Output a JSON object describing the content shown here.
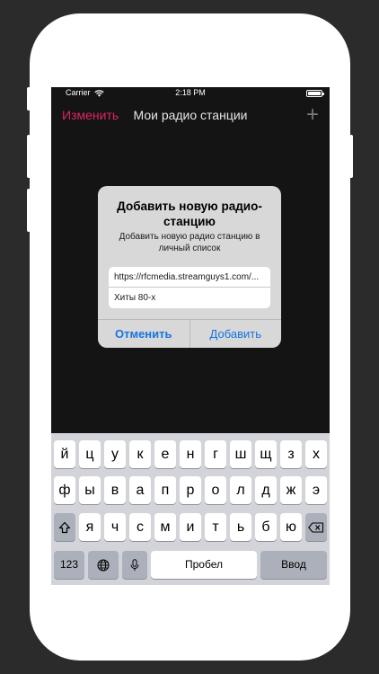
{
  "status_bar": {
    "carrier": "Carrier",
    "time": "2:18 PM"
  },
  "nav": {
    "edit_label": "Изменить",
    "title": "Мои радио станции",
    "add_label": "+"
  },
  "alert": {
    "title": "Добавить новую радио-станцию",
    "message": "Добавить новую радио станцию в личный список",
    "url_value": "https://rfcmedia.streamguys1.com/...",
    "name_value": "Хиты 80-х",
    "cancel_label": "Отменить",
    "add_label": "Добавить"
  },
  "keyboard": {
    "row1": [
      "й",
      "ц",
      "у",
      "к",
      "е",
      "н",
      "г",
      "ш",
      "щ",
      "з",
      "х"
    ],
    "row2": [
      "ф",
      "ы",
      "в",
      "а",
      "п",
      "р",
      "о",
      "л",
      "д",
      "ж",
      "э"
    ],
    "row3": [
      "я",
      "ч",
      "с",
      "м",
      "и",
      "т",
      "ь",
      "б",
      "ю"
    ],
    "numbers_label": "123",
    "space_label": "Пробел",
    "return_label": "Ввод"
  },
  "colors": {
    "accent": "#e0245e",
    "action_blue": "#1874e0",
    "screen_bg": "#141414"
  }
}
